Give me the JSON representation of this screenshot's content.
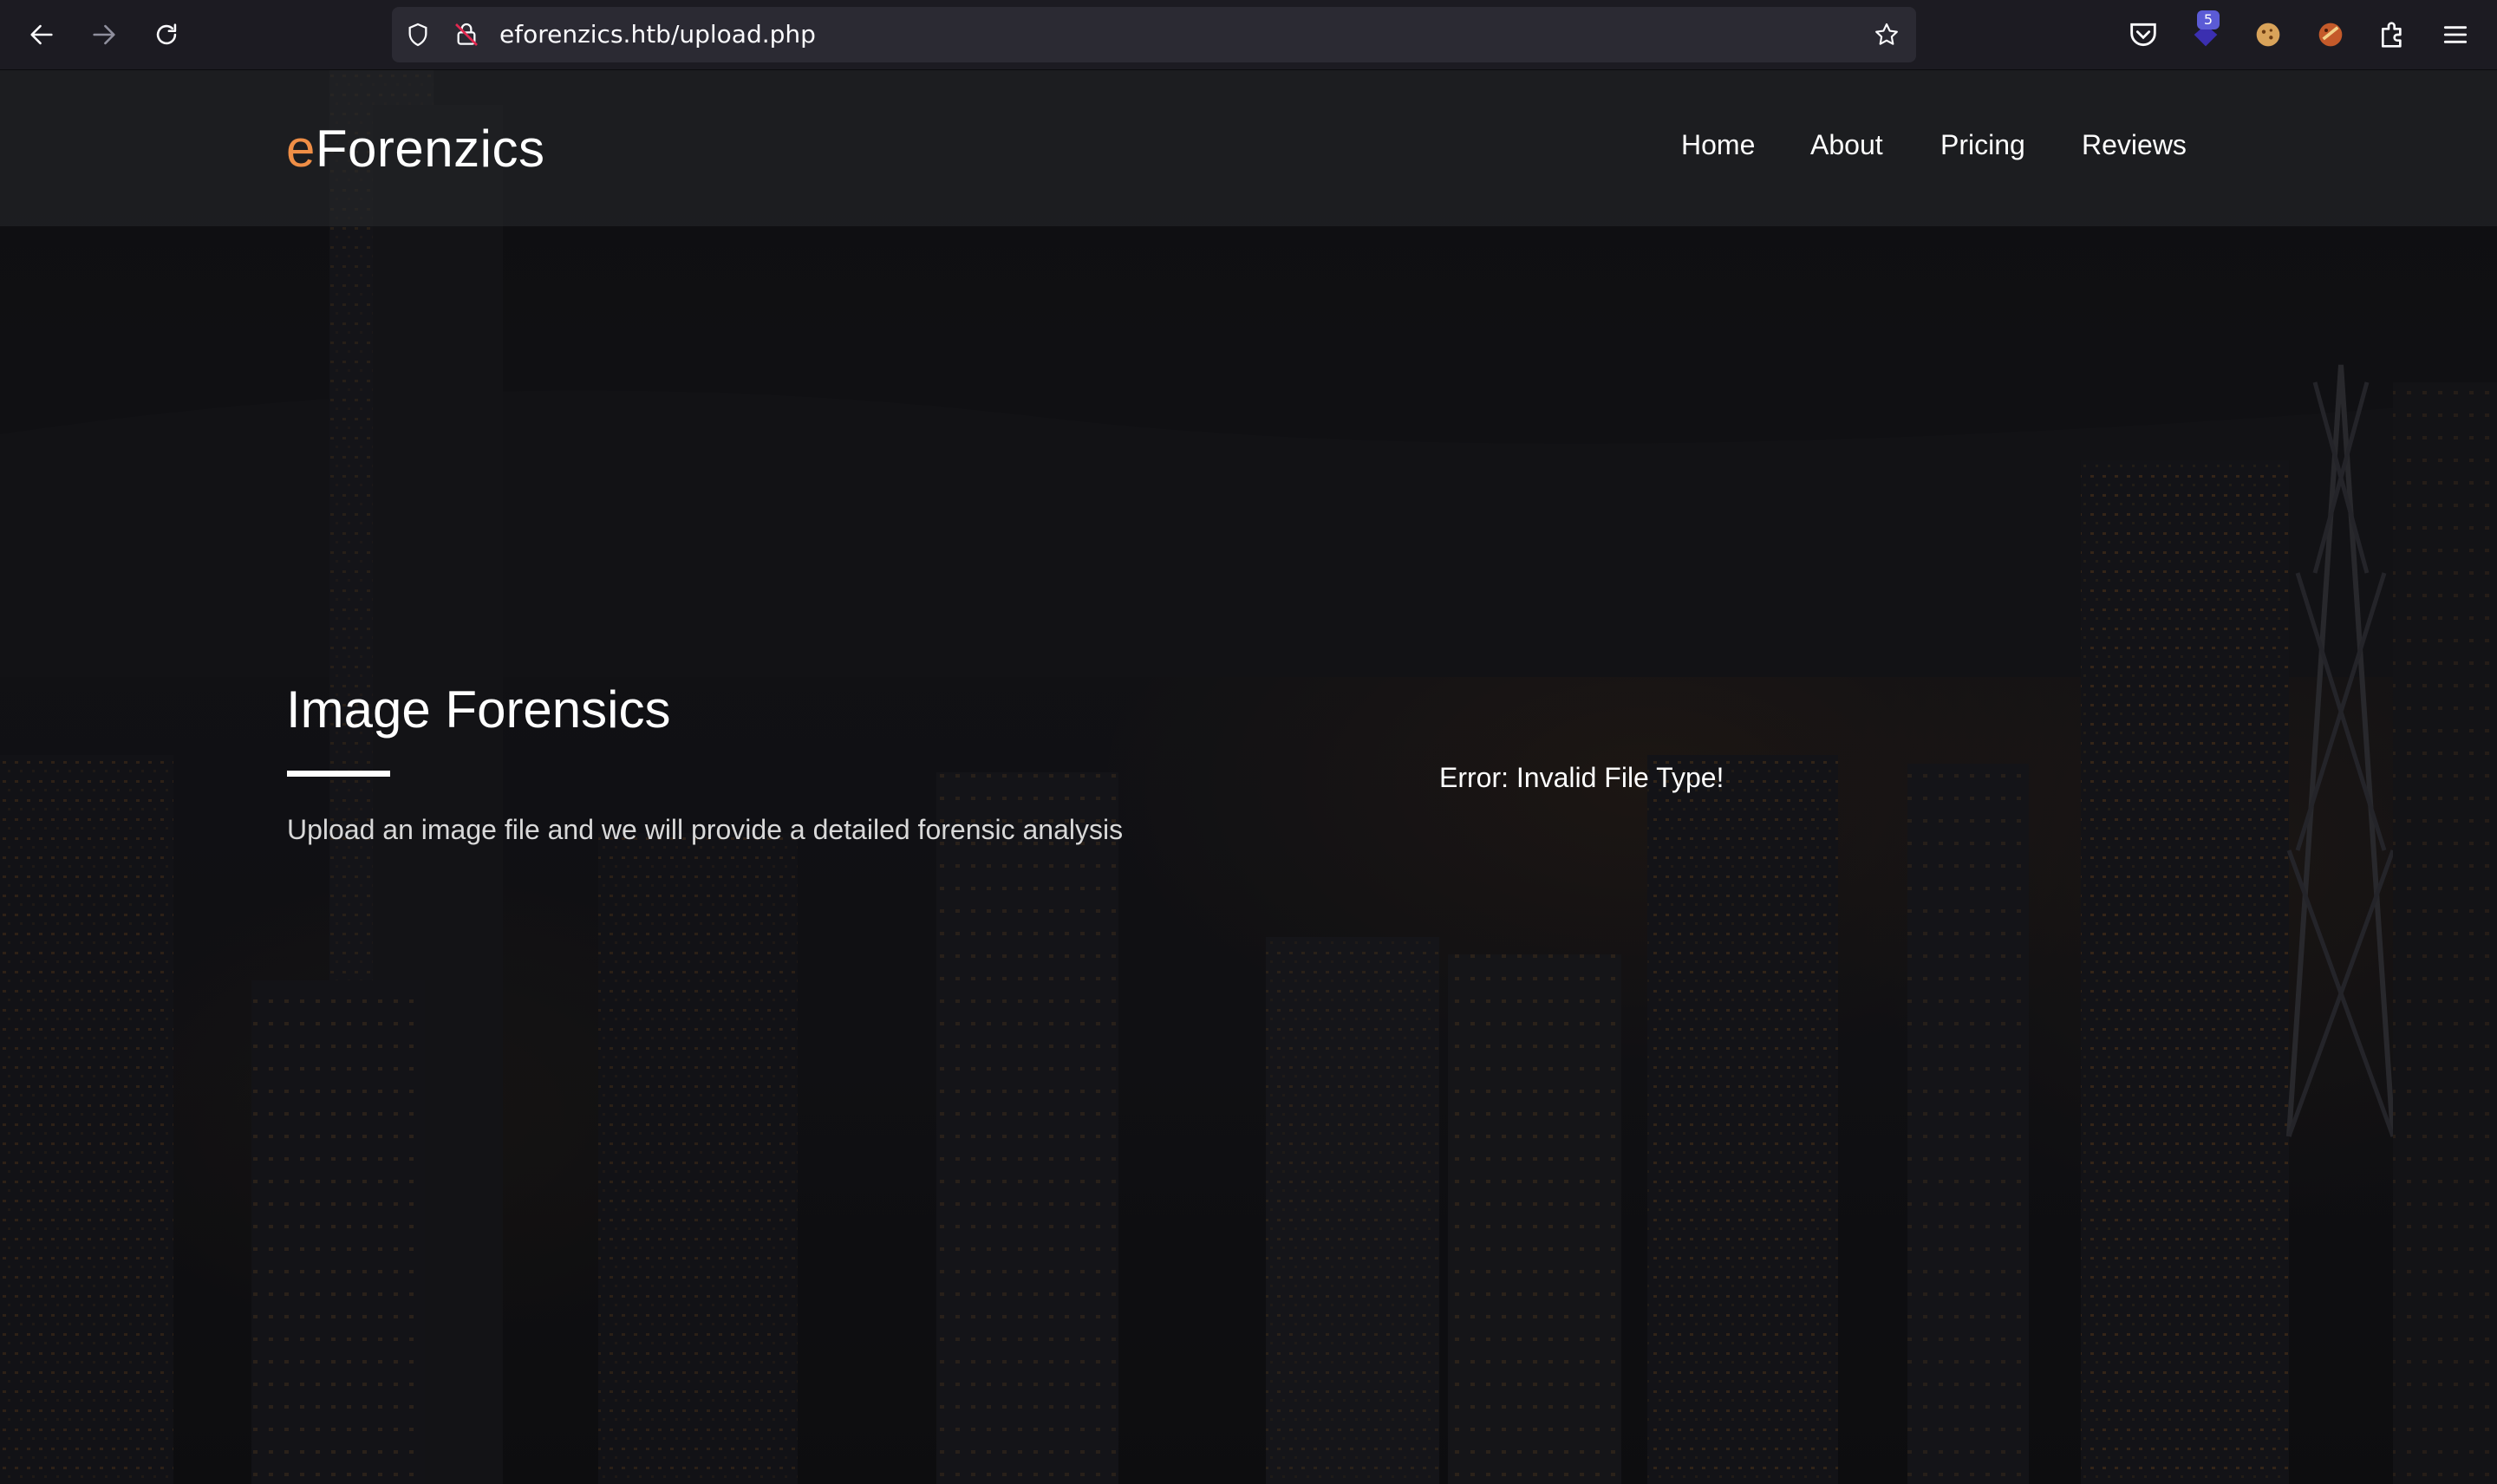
{
  "browser": {
    "url": "eforenzics.htb/upload.php",
    "extension_badge": "5",
    "icons": {
      "back": "arrow-left-icon",
      "forward": "arrow-right-icon",
      "reload": "reload-icon",
      "tracking": "shield-icon",
      "insecure": "insecure-lock-icon",
      "bookmark": "star-icon",
      "pocket": "pocket-icon",
      "extension_1": "extension-badge-icon",
      "extension_2": "cookie-icon",
      "extension_3": "cookie-editor-icon",
      "extensions": "puzzle-icon",
      "menu": "hamburger-menu-icon"
    }
  },
  "site": {
    "logo_accent": "e",
    "logo_rest": "Forenzics",
    "accent_color": "#ef8e46",
    "nav": [
      "Home",
      "About",
      "Pricing",
      "Reviews"
    ]
  },
  "hero": {
    "title": "Image Forensics",
    "subtitle": "Upload an image file and we will provide a detailed forensic analysis",
    "error": "Error: Invalid File Type!"
  }
}
